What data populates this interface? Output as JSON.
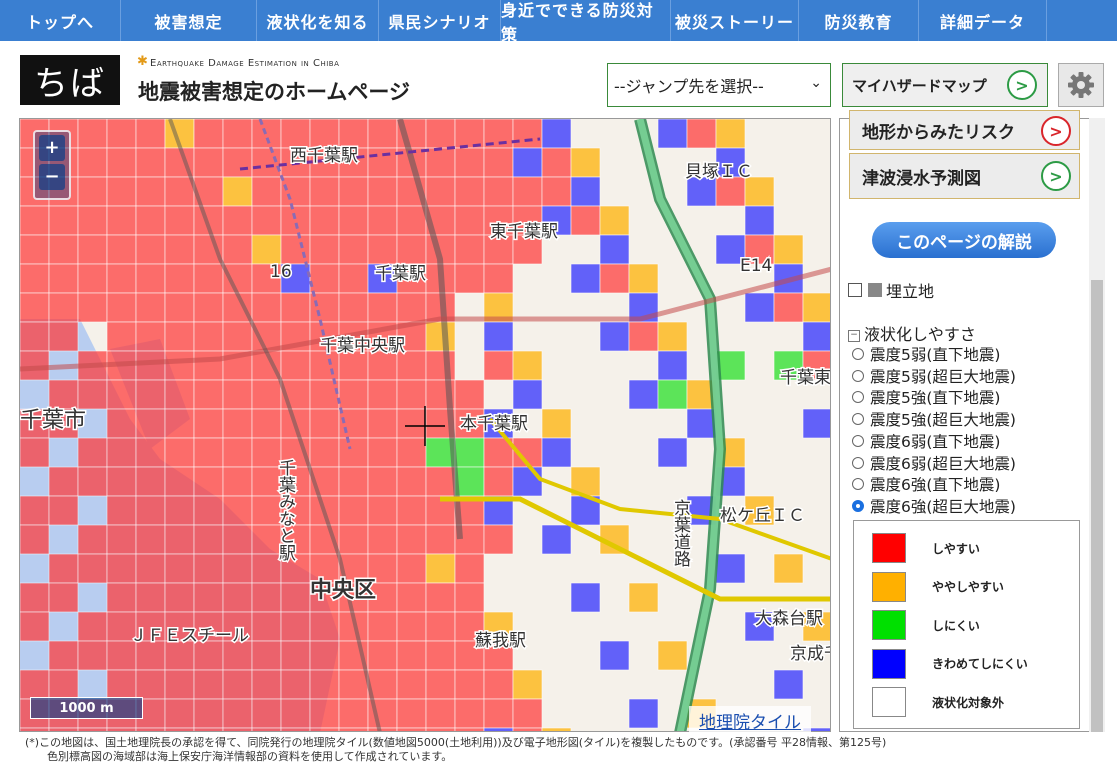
{
  "nav": [
    "トップへ",
    "被害想定",
    "液状化を知る",
    "県民シナリオ",
    "身近でできる防災対策",
    "被災ストーリー",
    "防災教育",
    "詳細データ"
  ],
  "header": {
    "logo_text": "ちば",
    "subtitle": "Earthquake Damage Estimation in Chiba",
    "title": "地震被害想定のホームページ",
    "jump_select": "--ジャンプ先を選択--",
    "hazard_button": "マイハザードマップ"
  },
  "map": {
    "labels": [
      "西千葉駅",
      "貝塚ＩＣ",
      "東千葉駅",
      "千葉駅",
      "千葉中央駅",
      "千葉みなと駅",
      "千葉市",
      "本千葉駅",
      "京葉道路",
      "松ケ丘ＩＣ",
      "中央区",
      "ＪＦＥスチール",
      "蘇我駅",
      "大森台駅",
      "京成千葉線",
      "E14",
      "千葉東",
      "16"
    ],
    "zoom_in": "+",
    "zoom_out": "−",
    "scale": "1000 m",
    "attribution": "地理院タイル"
  },
  "panel": {
    "terrain_button": "地形からみたリスク",
    "tsunami_button": "津波浸水予測図",
    "explain_button": "このページの解説",
    "landfill_label": "埋立地",
    "liquefaction_header": "液状化しやすさ",
    "options": [
      "震度5弱(直下地震)",
      "震度5弱(超巨大地震)",
      "震度5強(直下地震)",
      "震度5強(超巨大地震)",
      "震度6弱(直下地震)",
      "震度6弱(超巨大地震)",
      "震度6強(直下地震)",
      "震度6強(超巨大地震)"
    ],
    "selected_option": 7,
    "legend": [
      {
        "label": "しやすい",
        "color": "#ff0000"
      },
      {
        "label": "ややしやすい",
        "color": "#ffb000"
      },
      {
        "label": "しにくい",
        "color": "#00e000"
      },
      {
        "label": "きわめてしにくい",
        "color": "#0000ff"
      },
      {
        "label": "液状化対象外",
        "color": "#ffffff"
      }
    ]
  },
  "footnote": [
    "(*)この地図は、国土地理院長の承認を得て、同院発行の地理院タイル(数値地図5000(土地利用))及び電子地形図(タイル)を複製したものです。(承認番号 平28情報、第125号)",
    "色別標高図の海域部は海上保安庁海洋情報部の資料を使用して作成されています。"
  ]
}
